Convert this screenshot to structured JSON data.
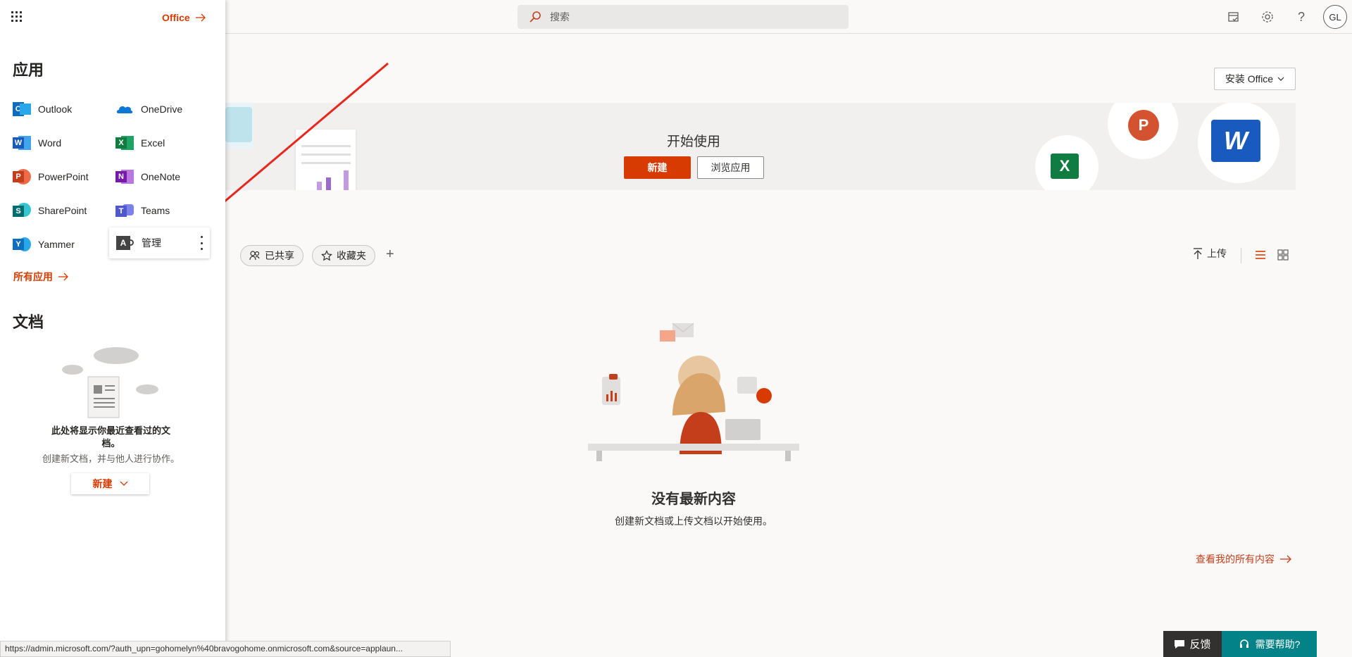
{
  "search": {
    "placeholder": "搜索"
  },
  "header": {
    "avatar_initials": "GL"
  },
  "main": {
    "install_label": "安装 Office",
    "hero": {
      "title": "开始使用",
      "new_label": "新建",
      "browse_label": "浏览应用"
    },
    "filters": [
      {
        "label": "已共享"
      },
      {
        "label": "收藏夹"
      }
    ],
    "upload_label": "上传",
    "empty": {
      "title": "没有最新内容",
      "subtitle": "创建新文档或上传文档以开始使用。"
    },
    "see_all_label": "查看我的所有内容"
  },
  "launcher": {
    "office_label": "Office",
    "apps_heading": "应用",
    "apps": [
      {
        "label": "Outlook",
        "color": "#0f6cbd"
      },
      {
        "label": "OneDrive",
        "color": "#0f78d4"
      },
      {
        "label": "Word",
        "color": "#185abd"
      },
      {
        "label": "Excel",
        "color": "#107c41"
      },
      {
        "label": "PowerPoint",
        "color": "#c43e1c"
      },
      {
        "label": "OneNote",
        "color": "#7719aa"
      },
      {
        "label": "SharePoint",
        "color": "#036c70"
      },
      {
        "label": "Teams",
        "color": "#5059c9"
      },
      {
        "label": "Yammer",
        "color": "#106ebe"
      },
      {
        "label": "管理",
        "color": "#444444"
      }
    ],
    "all_apps_label": "所有应用",
    "docs_heading": "文档",
    "docs_empty_title": "此处将显示你最近查看过的文档。",
    "docs_empty_subtitle": "创建新文档，并与他人进行协作。",
    "docs_new_label": "新建"
  },
  "status_url": "https://admin.microsoft.com/?auth_upn=gohomelyn%40bravogohome.onmicrosoft.com&source=applaun...",
  "footer": {
    "feedback_label": "反馈",
    "help_label": "需要帮助?"
  },
  "colors": {
    "accent": "#d83b01",
    "help": "#038387"
  }
}
